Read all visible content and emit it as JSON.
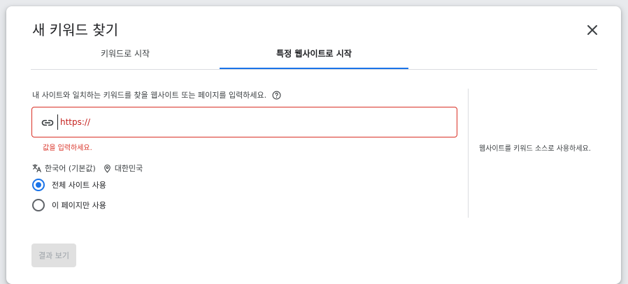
{
  "dialog": {
    "title": "새 키워드 찾기",
    "close_icon": "close-icon"
  },
  "tabs": [
    {
      "label": "키워드로 시작",
      "selected": false
    },
    {
      "label": "특정 웹사이트로 시작",
      "selected": true
    }
  ],
  "form": {
    "prompt": "내 사이트와 일치하는 키워드를 찾을 웹사이트 또는 페이지를 입력하세요.",
    "help_icon": "help-circle-icon",
    "url_icon": "link-icon",
    "url_value": "",
    "url_placeholder": "https://",
    "error": "값을 입력하세요."
  },
  "locale": {
    "language_icon": "translate-icon",
    "language": "한국어 (기본값)",
    "location_icon": "location-pin-icon",
    "location": "대한민국"
  },
  "scope_options": [
    {
      "label": "전체 사이트 사용",
      "selected": true
    },
    {
      "label": "이 페이지만 사용",
      "selected": false
    }
  ],
  "side_note": "웹사이트를 키워드 소스로 사용하세요.",
  "actions": {
    "results_label": "결과 보기",
    "results_enabled": false
  },
  "colors": {
    "accent": "#1a73e8",
    "error": "#d93025",
    "text": "#202124"
  }
}
